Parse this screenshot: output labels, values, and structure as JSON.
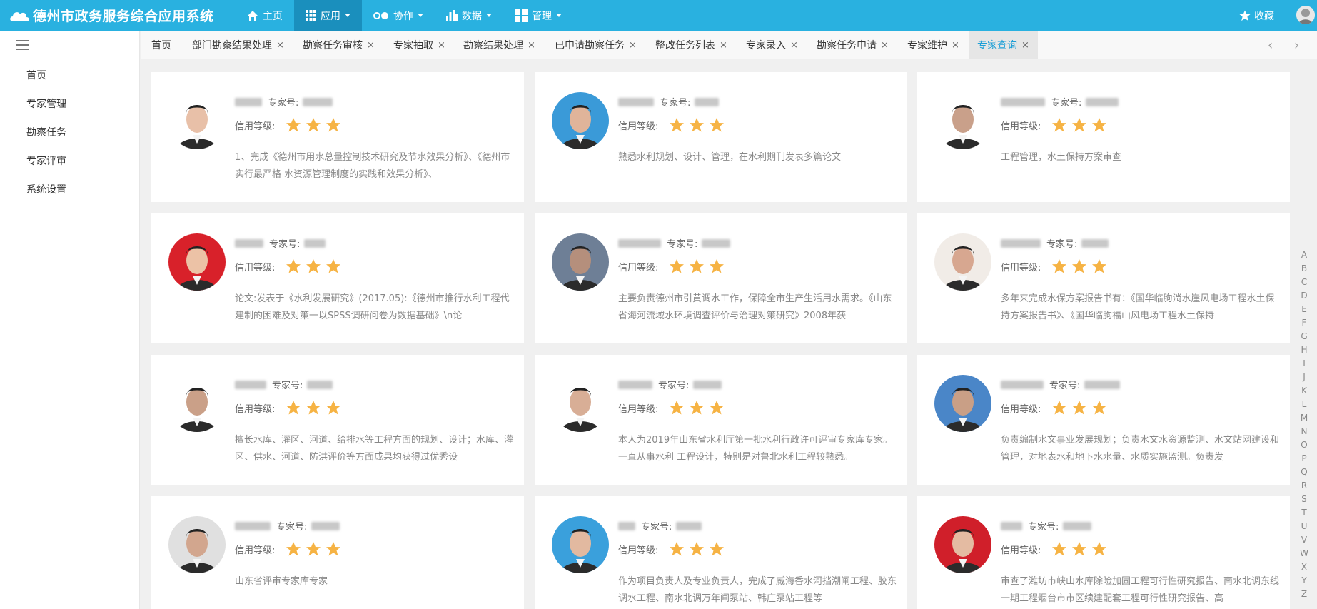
{
  "app": {
    "title": "德州市政务服务综合应用系统"
  },
  "menu": [
    {
      "label": "主页",
      "icon": "home-icon",
      "dropdown": false
    },
    {
      "label": "应用",
      "icon": "grid-icon",
      "dropdown": true
    },
    {
      "label": "协作",
      "icon": "toggle-icon",
      "dropdown": true
    },
    {
      "label": "数据",
      "icon": "bar-chart-icon",
      "dropdown": true
    },
    {
      "label": "管理",
      "icon": "apps-icon",
      "dropdown": true
    }
  ],
  "header_right": {
    "favorites_label": "收藏"
  },
  "sidebar": {
    "items": [
      {
        "label": "首页"
      },
      {
        "label": "专家管理"
      },
      {
        "label": "勘察任务"
      },
      {
        "label": "专家评审"
      },
      {
        "label": "系统设置"
      }
    ]
  },
  "tabs": [
    {
      "label": "首页",
      "closable": false
    },
    {
      "label": "部门勘察结果处理",
      "closable": true
    },
    {
      "label": "勘察任务审核",
      "closable": true
    },
    {
      "label": "专家抽取",
      "closable": true
    },
    {
      "label": "勘察结果处理",
      "closable": true
    },
    {
      "label": "已申请勘察任务",
      "closable": true
    },
    {
      "label": "整改任务列表",
      "closable": true
    },
    {
      "label": "专家录入",
      "closable": true
    },
    {
      "label": "勘察任务申请",
      "closable": true
    },
    {
      "label": "专家维护",
      "closable": true
    },
    {
      "label": "专家查询",
      "closable": true,
      "active": true
    }
  ],
  "tab_close_glyph": "×",
  "labels": {
    "expert_no": "专家号:",
    "credit": "信用等级:"
  },
  "experts": [
    {
      "desc": "1、完成《德州市用水总量控制技术研究及节水效果分析》、《德州市实行最严格 水资源管理制度的实践和效果分析》、",
      "stars": 3,
      "bg": "#ffffff",
      "face": "#e8c0a8"
    },
    {
      "desc": "熟悉水利规划、设计、管理，在水利期刊发表多篇论文",
      "stars": 3,
      "bg": "#3a9ad8",
      "face": "#e0b49a"
    },
    {
      "desc": "工程管理，水土保持方案审查",
      "stars": 3,
      "bg": "#ffffff",
      "face": "#c9a08a"
    },
    {
      "desc": "论文:发表于《水利发展研究》(2017.05):《德州市推行水利工程代建制的困难及对策一以SPSS调研问卷为数据基础》\\n论",
      "stars": 3,
      "bg": "#d8212a",
      "face": "#ecc2a6"
    },
    {
      "desc": "主要负责德州市引黄调水工作，保障全市生产生活用水需求。《山东省海河流域水环境调查评价与治理对策研究》2008年获",
      "stars": 3,
      "bg": "#6e7f96",
      "face": "#b58f7c"
    },
    {
      "desc": "多年来完成水保方案报告书有：《国华临朐淌水崖风电场工程水土保持方案报告书》、《国华临朐福山风电场工程水土保持",
      "stars": 3,
      "bg": "#f1ece7",
      "face": "#d7a790"
    },
    {
      "desc": "擅长水库、灌区、河道、给排水等工程方面的规划、设计；水库、灌区、供水、河道、防洪评价等方面成果均获得过优秀设",
      "stars": 3,
      "bg": "#ffffff",
      "face": "#caa088"
    },
    {
      "desc": "本人为2019年山东省水利厅第一批水利行政许可评审专家库专家。一直从事水利 工程设计，特别是对鲁北水利工程较熟悉。",
      "stars": 3,
      "bg": "#ffffff",
      "face": "#d8ae96"
    },
    {
      "desc": "负责编制水文事业发展规划；负责水文水资源监测、水文站网建设和管理，对地表水和地下水水量、水质实施监测。负责发",
      "stars": 3,
      "bg": "#4a86c8",
      "face": "#c99f86"
    },
    {
      "desc": "山东省评审专家库专家",
      "stars": 3,
      "bg": "#e0e0e0",
      "face": "#d2a68e"
    },
    {
      "desc": "作为项目负责人及专业负责人，完成了威海香水河挡潮闸工程、胶东调水工程、南水北调万年闸泵站、韩庄泵站工程等",
      "stars": 3,
      "bg": "#3aa0dc",
      "face": "#e2b9a0"
    },
    {
      "desc": "审查了潍坊市峡山水库除险加固工程可行性研究报告、南水北调东线一期工程烟台市市区续建配套工程可行性研究报告、高",
      "stars": 3,
      "bg": "#d01f2a",
      "face": "#e4bba2"
    }
  ],
  "alphabet": [
    "A",
    "B",
    "C",
    "D",
    "E",
    "F",
    "G",
    "H",
    "I",
    "J",
    "K",
    "L",
    "M",
    "N",
    "O",
    "P",
    "Q",
    "R",
    "S",
    "T",
    "U",
    "V",
    "W",
    "X",
    "Y",
    "Z"
  ],
  "colors": {
    "header": "#29b1e0",
    "active_menu": "#1a8fbd",
    "active_tab_text": "#1e9fd6",
    "star": "#f5a623"
  }
}
